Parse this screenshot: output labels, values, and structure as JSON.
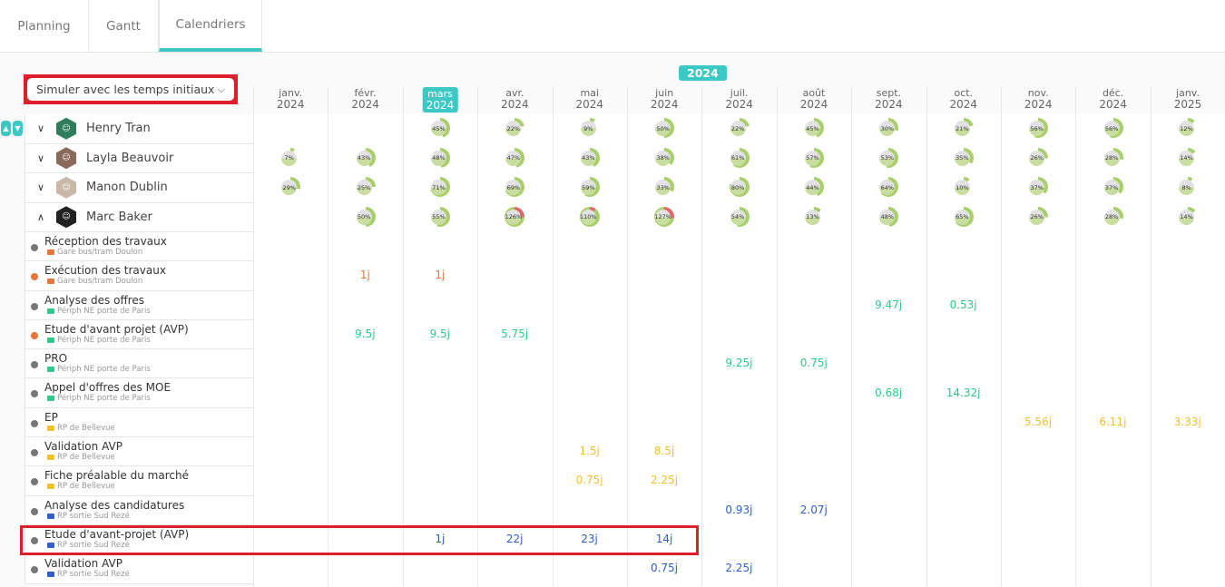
{
  "tabs": [
    {
      "label": "Planning"
    },
    {
      "label": "Gantt"
    },
    {
      "label": "Calendriers",
      "active": true
    }
  ],
  "simulation_dropdown": {
    "value": "Simuler avec les temps initiaux"
  },
  "year_label": "2024",
  "current_month_index": 2,
  "months": [
    {
      "m": "janv.",
      "y": "2024"
    },
    {
      "m": "févr.",
      "y": "2024"
    },
    {
      "m": "mars",
      "y": "2024"
    },
    {
      "m": "avr.",
      "y": "2024"
    },
    {
      "m": "mai",
      "y": "2024"
    },
    {
      "m": "juin",
      "y": "2024"
    },
    {
      "m": "juil.",
      "y": "2024"
    },
    {
      "m": "août",
      "y": "2024"
    },
    {
      "m": "sept.",
      "y": "2024"
    },
    {
      "m": "oct.",
      "y": "2024"
    },
    {
      "m": "nov.",
      "y": "2024"
    },
    {
      "m": "déc.",
      "y": "2024"
    },
    {
      "m": "janv.",
      "y": "2025"
    }
  ],
  "people": [
    {
      "name": "Henry Tran",
      "expanded": false,
      "avatar_color": "#2e7d5b",
      "load": [
        null,
        null,
        45,
        22,
        9,
        50,
        22,
        45,
        30,
        21,
        56,
        56,
        12
      ]
    },
    {
      "name": "Layla Beauvoir",
      "expanded": false,
      "avatar_color": "#8a6a5a",
      "load": [
        7,
        43,
        48,
        47,
        43,
        38,
        61,
        57,
        53,
        35,
        26,
        28,
        14
      ]
    },
    {
      "name": "Manon Dublin",
      "expanded": false,
      "avatar_color": "#c9b8a8",
      "load": [
        29,
        25,
        71,
        69,
        59,
        33,
        80,
        44,
        64,
        10,
        37,
        37,
        8
      ]
    },
    {
      "name": "Marc Baker",
      "expanded": true,
      "avatar_color": "#222222",
      "load": [
        null,
        50,
        55,
        126,
        110,
        127,
        54,
        13,
        48,
        65,
        26,
        28,
        14
      ]
    }
  ],
  "tasks": [
    {
      "name": "Réception des travaux",
      "project": "Gare bus/tram Doulon",
      "dot": "#777777",
      "color": "#e8763a",
      "values": []
    },
    {
      "name": "Exécution des travaux",
      "project": "Gare bus/tram Doulon",
      "dot": "#e8763a",
      "color": "#e8763a",
      "values": [
        [
          1,
          "1j"
        ],
        [
          2,
          "1j"
        ]
      ]
    },
    {
      "name": "Analyse des offres",
      "project": "Périph NE porte de Paris",
      "dot": "#777777",
      "color": "#2ec98a",
      "values": [
        [
          8,
          "9.47j"
        ],
        [
          9,
          "0.53j"
        ]
      ]
    },
    {
      "name": "Etude d'avant projet (AVP)",
      "project": "Périph NE porte de Paris",
      "dot": "#e8763a",
      "color": "#2ec98a",
      "values": [
        [
          1,
          "9.5j"
        ],
        [
          2,
          "9.5j"
        ],
        [
          3,
          "5.75j"
        ]
      ]
    },
    {
      "name": "PRO",
      "project": "Périph NE porte de Paris",
      "dot": "#777777",
      "color": "#2ec98a",
      "values": [
        [
          6,
          "9.25j"
        ],
        [
          7,
          "0.75j"
        ]
      ]
    },
    {
      "name": "Appel d'offres des MOE",
      "project": "Périph NE porte de Paris",
      "dot": "#777777",
      "color": "#2ec98a",
      "values": [
        [
          8,
          "0.68j"
        ],
        [
          9,
          "14.32j"
        ]
      ]
    },
    {
      "name": "EP",
      "project": "RP de Bellevue",
      "dot": "#777777",
      "color": "#f2c12e",
      "values": [
        [
          10,
          "5.56j"
        ],
        [
          11,
          "6.11j"
        ],
        [
          12,
          "3.33j"
        ]
      ]
    },
    {
      "name": "Validation AVP",
      "project": "RP de Bellevue",
      "dot": "#777777",
      "color": "#f2c12e",
      "values": [
        [
          4,
          "1.5j"
        ],
        [
          5,
          "8.5j"
        ]
      ]
    },
    {
      "name": "Fiche préalable du marché",
      "project": "RP de Bellevue",
      "dot": "#777777",
      "color": "#f2c12e",
      "values": [
        [
          4,
          "0.75j"
        ],
        [
          5,
          "2.25j"
        ]
      ]
    },
    {
      "name": "Analyse des candidatures",
      "project": "RP sortie Sud Rezé",
      "dot": "#777777",
      "color": "#2f5fc8",
      "values": [
        [
          6,
          "0.93j"
        ],
        [
          7,
          "2.07j"
        ]
      ]
    },
    {
      "name": "Etude d'avant-projet (AVP)",
      "project": "RP sortie Sud Rezé",
      "dot": "#777777",
      "color": "#2f5fc8",
      "values": [
        [
          2,
          "1j"
        ],
        [
          3,
          "22j"
        ],
        [
          4,
          "23j"
        ],
        [
          5,
          "14j"
        ]
      ]
    },
    {
      "name": "Validation AVP",
      "project": "RP sortie Sud Rezé",
      "dot": "#777777",
      "color": "#2f5fc8",
      "values": [
        [
          5,
          "0.75j"
        ],
        [
          6,
          "2.25j"
        ]
      ]
    }
  ],
  "colors": {
    "accent": "#3cc8c4",
    "highlight": "#dc1f2a",
    "load_ok": "#a8cf6a",
    "load_over": "#e06a6a"
  }
}
